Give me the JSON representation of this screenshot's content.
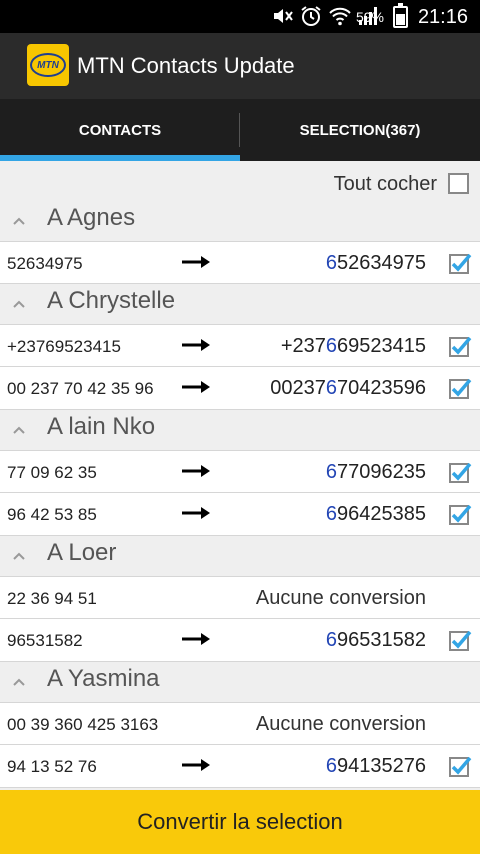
{
  "status_bar": {
    "battery_percent": "59%",
    "battery_level": 0.59,
    "time": "21:16",
    "icons": [
      "mute-icon",
      "alarm-icon",
      "wifi-icon",
      "signal-icon",
      "battery-icon"
    ]
  },
  "app": {
    "title": "MTN Contacts Update",
    "logo_text": "MTN",
    "brand_color": "#f9c90a",
    "accent_color": "#33a5e5",
    "highlight_color": "#2346b5"
  },
  "tabs": [
    {
      "label": "CONTACTS",
      "selected": true
    },
    {
      "label": "SELECTION(367)",
      "selected": false
    }
  ],
  "check_all": {
    "label": "Tout cocher",
    "checked": false
  },
  "groups": [
    {
      "name": "A Agnes",
      "rows": [
        {
          "original": "52634975",
          "prefix": "",
          "highlight": "6",
          "rest": "52634975",
          "checked": true
        }
      ]
    },
    {
      "name": "A Chrystelle",
      "rows": [
        {
          "original": "+23769523415",
          "prefix": "+237",
          "highlight": "6",
          "rest": "69523415",
          "checked": true
        },
        {
          "original": "00 237 70 42 35 96",
          "prefix": "00237",
          "highlight": "6",
          "rest": "70423596",
          "checked": true
        }
      ]
    },
    {
      "name": "A lain Nko",
      "rows": [
        {
          "original": "77 09 62 35",
          "prefix": "",
          "highlight": "6",
          "rest": "77096235",
          "checked": true
        },
        {
          "original": "96 42 53 85",
          "prefix": "",
          "highlight": "6",
          "rest": "96425385",
          "checked": true
        }
      ]
    },
    {
      "name": "A Loer",
      "rows": [
        {
          "original": "22 36 94 51",
          "no_conversion": "Aucune conversion"
        },
        {
          "original": "96531582",
          "prefix": "",
          "highlight": "6",
          "rest": "96531582",
          "checked": true
        }
      ]
    },
    {
      "name": "A Yasmina",
      "rows": [
        {
          "original": "00 39 360 425 3163",
          "no_conversion": "Aucune conversion"
        },
        {
          "original": "94 13 52 76",
          "prefix": "",
          "highlight": "6",
          "rest": "94135276",
          "checked": true
        }
      ]
    }
  ],
  "convert_button": {
    "label": "Convertir la selection"
  }
}
